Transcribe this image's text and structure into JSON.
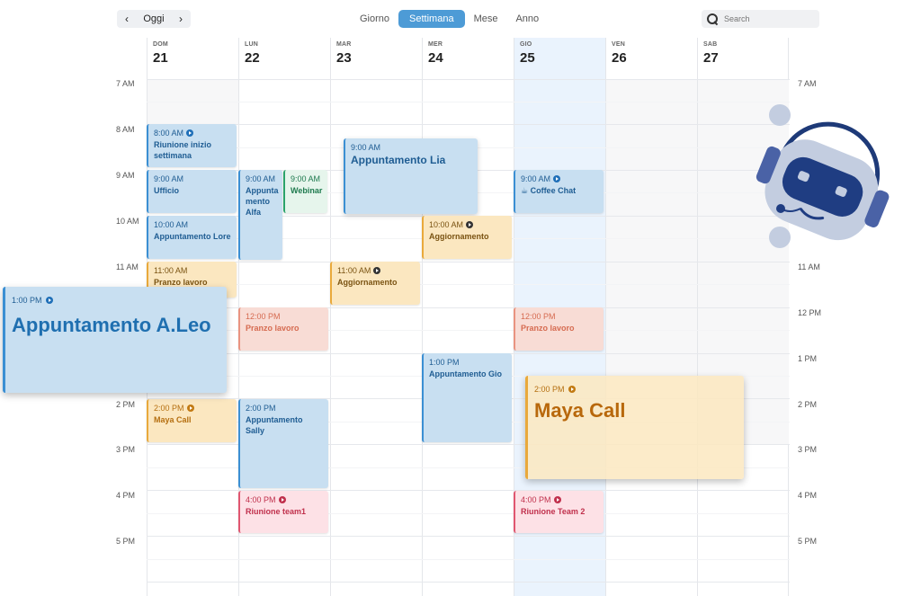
{
  "toolbar": {
    "prev": "‹",
    "today": "Oggi",
    "next": "›",
    "views": [
      "Giorno",
      "Settimana",
      "Mese",
      "Anno"
    ],
    "active_view": "Settimana",
    "search_placeholder": "Search"
  },
  "days": [
    {
      "name": "DOM",
      "num": "21"
    },
    {
      "name": "LUN",
      "num": "22"
    },
    {
      "name": "MAR",
      "num": "23"
    },
    {
      "name": "MER",
      "num": "24"
    },
    {
      "name": "GIO",
      "num": "25"
    },
    {
      "name": "VEN",
      "num": "26"
    },
    {
      "name": "SAB",
      "num": "27"
    }
  ],
  "hours": [
    "7 AM",
    "8 AM",
    "9 AM",
    "10 AM",
    "11 AM",
    "12 PM",
    "1 PM",
    "2 PM",
    "3 PM",
    "4 PM",
    "5 PM"
  ],
  "events": {
    "dom_riunione": {
      "time": "8:00 AM",
      "name": "Riunione inizio settimana"
    },
    "dom_ufficio": {
      "time": "9:00 AM",
      "name": "Ufficio"
    },
    "dom_lore": {
      "time": "10:00 AM",
      "name": "Appuntamento Lore"
    },
    "dom_pranzo": {
      "time": "11:00 AM",
      "name": "Pranzo lavoro"
    },
    "dom_maya": {
      "time": "2:00 PM",
      "name": "Maya Call"
    },
    "lun_alfa": {
      "time": "9:00 AM",
      "name": "Appunta mento Alfa"
    },
    "lun_webinar": {
      "time": "9:00 AM",
      "name": "Webinar"
    },
    "lun_pranzo": {
      "time": "12:00 PM",
      "name": "Pranzo lavoro"
    },
    "lun_sally": {
      "time": "2:00 PM",
      "name": "Appuntamento Sally"
    },
    "lun_team1": {
      "time": "4:00 PM",
      "name": "Riunione team1"
    },
    "mar_lia": {
      "time": "9:00 AM",
      "name": "Appuntamento Lia"
    },
    "mar_agg": {
      "time": "11:00 AM",
      "name": "Aggiornamento"
    },
    "mer_agg": {
      "time": "10:00 AM",
      "name": "Aggiornamento"
    },
    "mer_gio": {
      "time": "1:00 PM",
      "name": "Appuntamento Gio"
    },
    "gio_coffee": {
      "time": "9:00 AM",
      "name": "☕ Coffee Chat"
    },
    "gio_pranzo": {
      "time": "12:00 PM",
      "name": "Pranzo lavoro"
    },
    "gio_team2": {
      "time": "4:00 PM",
      "name": "Riunione Team 2"
    }
  },
  "featured": {
    "leo": {
      "time": "1:00 PM",
      "name": "Appuntamento A.Leo"
    },
    "maya": {
      "time": "2:00 PM",
      "name": "Maya Call"
    }
  },
  "colors": {
    "accent": "#4d9bd6",
    "blue_event": "#c8dff1",
    "orange_event": "#fbe7c0",
    "green_event": "#e6f5ec",
    "salmon_event": "#f8dcd5",
    "pink_event": "#fde1e6",
    "today_column": "#eaf3fd"
  },
  "mascot": "robot-headset-icon"
}
